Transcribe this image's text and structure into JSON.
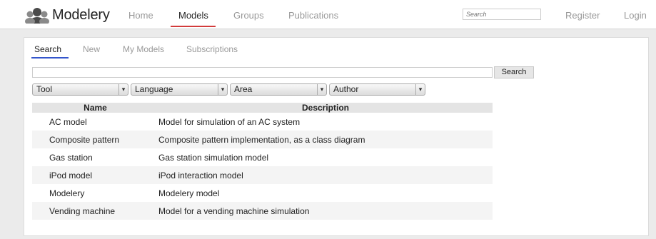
{
  "header": {
    "brand": "Modelery",
    "nav": [
      {
        "label": "Home",
        "active": false
      },
      {
        "label": "Models",
        "active": true
      },
      {
        "label": "Groups",
        "active": false
      },
      {
        "label": "Publications",
        "active": false
      }
    ],
    "search_placeholder": "Search",
    "register_label": "Register",
    "login_label": "Login",
    "accent_color": "#d23b3b"
  },
  "tabs": [
    {
      "label": "Search",
      "active": true
    },
    {
      "label": "New",
      "active": false
    },
    {
      "label": "My Models",
      "active": false
    },
    {
      "label": "Subscriptions",
      "active": false
    }
  ],
  "search": {
    "value": "",
    "button_label": "Search"
  },
  "filters": [
    {
      "label": "Tool"
    },
    {
      "label": "Language"
    },
    {
      "label": "Area"
    },
    {
      "label": "Author"
    }
  ],
  "table": {
    "columns": [
      "Name",
      "Description"
    ],
    "rows": [
      {
        "name": "AC model",
        "description": "Model for simulation of an AC system"
      },
      {
        "name": "Composite pattern",
        "description": "Composite pattern implementation, as a class diagram"
      },
      {
        "name": "Gas station",
        "description": "Gas station simulation model"
      },
      {
        "name": "iPod model",
        "description": "iPod interaction model"
      },
      {
        "name": "Modelery",
        "description": "Modelery model"
      },
      {
        "name": "Vending machine",
        "description": "Model for a vending machine simulation"
      }
    ]
  }
}
